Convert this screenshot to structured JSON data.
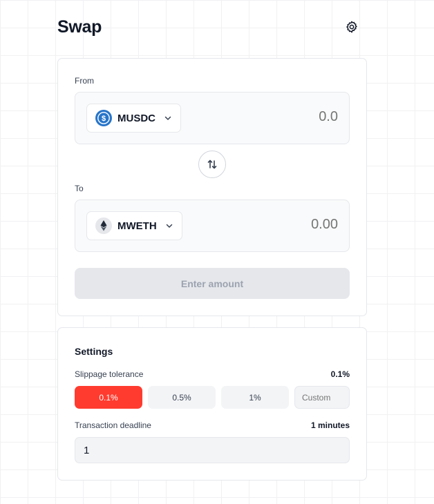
{
  "header": {
    "title": "Swap",
    "settings_icon": "gear-icon"
  },
  "swap": {
    "from": {
      "label": "From",
      "token": "MUSDC",
      "token_icon": "usdc-icon",
      "amount": "0.0"
    },
    "to": {
      "label": "To",
      "token": "MWETH",
      "token_icon": "eth-icon",
      "amount": "0.00"
    },
    "switch_icon": "swap-arrows-icon",
    "submit_label": "Enter amount"
  },
  "settings": {
    "title": "Settings",
    "slippage": {
      "label": "Slippage tolerance",
      "value": "0.1%",
      "options": [
        "0.1%",
        "0.5%",
        "1%"
      ],
      "selected": "0.1%",
      "custom_placeholder": "Custom"
    },
    "deadline": {
      "label": "Transaction deadline",
      "value_text": "1 minutes",
      "input_value": "1"
    }
  },
  "colors": {
    "accent": "#ff3b2f",
    "usdc": "#2775ca",
    "muted": "#9ca3af"
  }
}
